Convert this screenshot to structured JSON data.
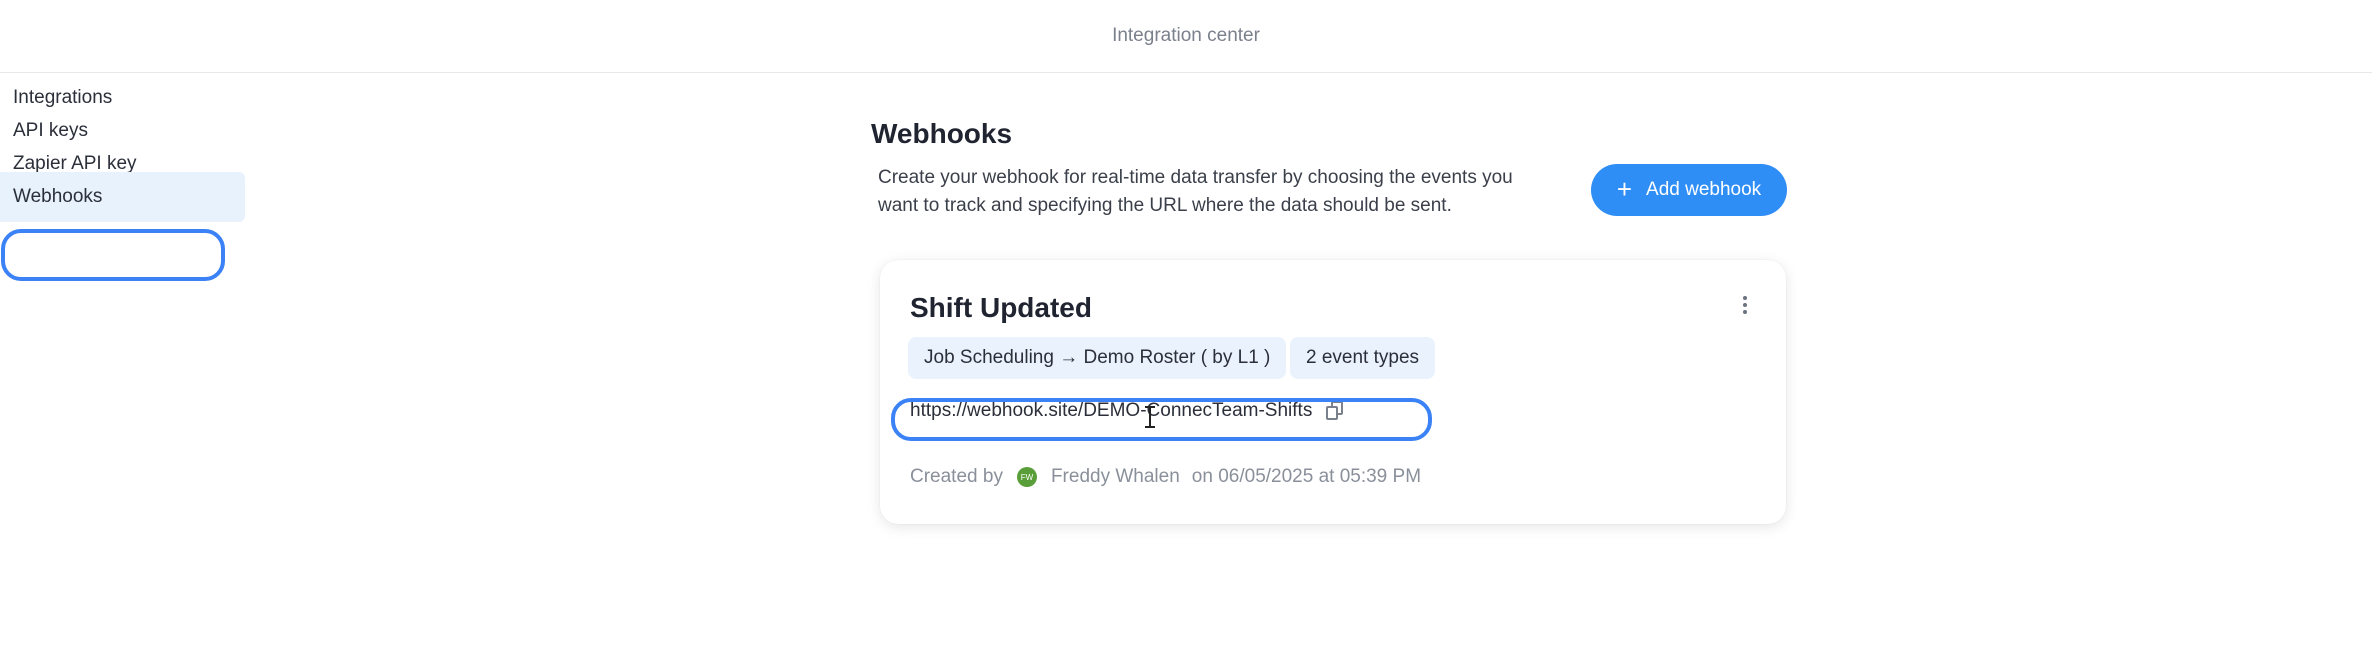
{
  "header": {
    "title": "Integration center"
  },
  "sidebar": {
    "items": [
      {
        "label": "Integrations"
      },
      {
        "label": "API keys"
      },
      {
        "label": "Zapier API key"
      },
      {
        "label": "Webhooks"
      }
    ]
  },
  "main": {
    "heading": "Webhooks",
    "description": "Create your webhook for real-time data transfer by choosing the events you want to track and specifying the URL where the data should be sent.",
    "add_button": {
      "icon": "plus-icon",
      "label": "Add webhook"
    },
    "webhook": {
      "title": "Shift Updated",
      "chips": [
        "Job Scheduling → Demo Roster ( by L1 )",
        "2 event types"
      ],
      "url": "https://webhook.site/DEMO-ConnecTeam-Shifts",
      "created_by_label": "Created by",
      "avatar_initials": "FW",
      "creator": "Freddy Whalen",
      "created_on": "on 06/05/2025 at 05:39 PM"
    }
  },
  "colors": {
    "accent": "#2f8ef5",
    "highlight": "#3b82f6",
    "chip_bg": "#eaf3fd",
    "avatar": "#5a9e3a"
  }
}
